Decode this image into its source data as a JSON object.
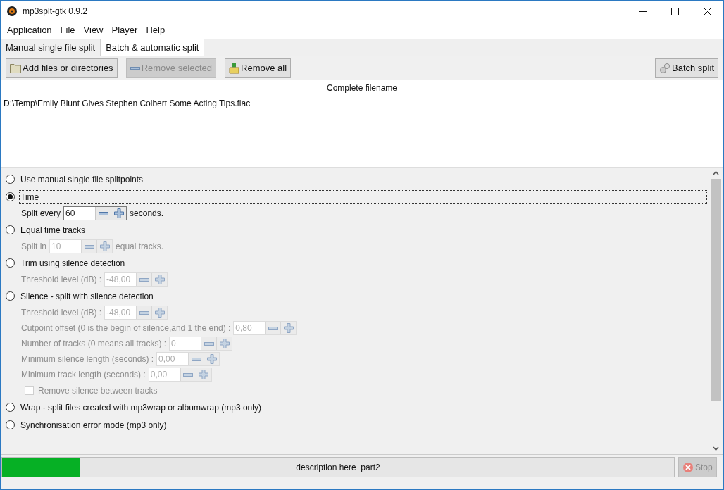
{
  "window": {
    "title": "mp3splt-gtk 0.9.2"
  },
  "menu": [
    "Application",
    "File",
    "View",
    "Player",
    "Help"
  ],
  "tabs": [
    {
      "label": "Manual single file split",
      "selected": false
    },
    {
      "label": "Batch & automatic split",
      "selected": true
    }
  ],
  "toolbar": [
    {
      "label": "Add files or directories",
      "disabled": false
    },
    {
      "label": "Remove selected",
      "disabled": true
    },
    {
      "label": "Remove all",
      "disabled": false
    }
  ],
  "batch_button": {
    "label": "Batch split"
  },
  "file_list": {
    "column": "Complete filename",
    "rows": [
      "D:\\Temp\\Emily Blunt Gives Stephen Colbert Some Acting Tips.flac"
    ]
  },
  "split_modes": [
    {
      "label": "Use manual single file splitpoints",
      "selected": false
    },
    {
      "label": "Time",
      "selected": true,
      "params": [
        {
          "kind": "spin",
          "label": "Split every",
          "value": "60",
          "suffix": "seconds.",
          "disabled": false
        }
      ]
    },
    {
      "label": "Equal time tracks",
      "selected": false,
      "params": [
        {
          "kind": "spin",
          "label": "Split in",
          "value": "10",
          "suffix": "equal tracks.",
          "disabled": true
        }
      ]
    },
    {
      "label": "Trim using silence detection",
      "selected": false,
      "params": [
        {
          "kind": "spin",
          "label": "Threshold level (dB) :",
          "value": "-48,00",
          "disabled": true
        }
      ]
    },
    {
      "label": "Silence - split with silence detection",
      "selected": false,
      "params": [
        {
          "kind": "spin",
          "label": "Threshold level (dB) :",
          "value": "-48,00",
          "disabled": true
        },
        {
          "kind": "spin",
          "label": "Cutpoint offset (0 is the begin of silence,and 1 the end) :",
          "value": "0,80",
          "disabled": true
        },
        {
          "kind": "spin",
          "label": "Number of tracks (0 means all tracks) :",
          "value": "0",
          "disabled": true
        },
        {
          "kind": "spin",
          "label": "Minimum silence length (seconds) :",
          "value": "0,00",
          "disabled": true
        },
        {
          "kind": "spin",
          "label": "Minimum track length (seconds) :",
          "value": "0,00",
          "disabled": true
        },
        {
          "kind": "checkbox",
          "label": "Remove silence between tracks",
          "checked": false,
          "disabled": true
        }
      ]
    },
    {
      "label": "Wrap - split files created with mp3wrap or albumwrap (mp3 only)",
      "selected": false
    },
    {
      "label": "Synchronisation error mode (mp3 only)",
      "selected": false
    }
  ],
  "progress": {
    "level": 0.115,
    "text": "description here_part2"
  },
  "stop_button": {
    "label": "Stop",
    "disabled": true
  }
}
